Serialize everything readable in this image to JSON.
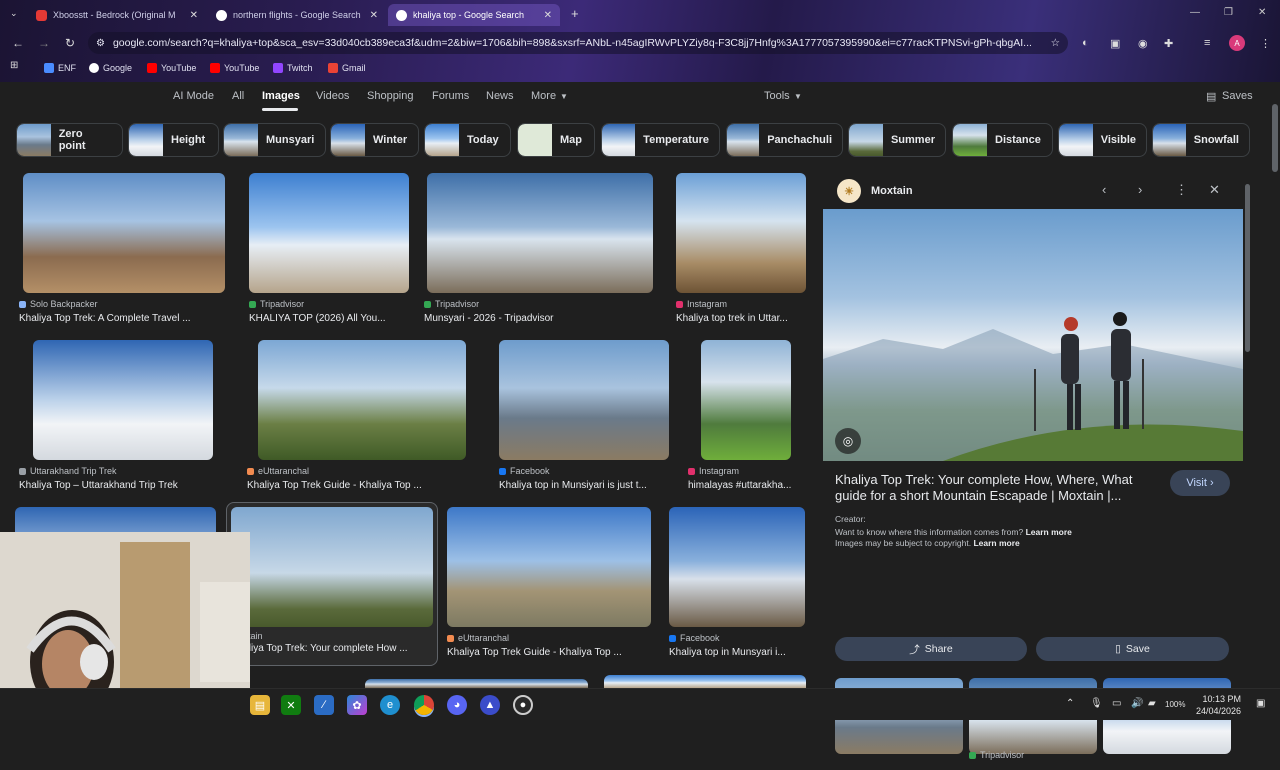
{
  "browser": {
    "tabs": [
      {
        "label": "Xboosstt - Bedrock (Original M",
        "color": "#e53935"
      },
      {
        "label": "northern flights - Google Search",
        "color": "#4285f4"
      },
      {
        "label": "khaliya top - Google Search",
        "color": "#4285f4"
      }
    ],
    "url": "google.com/search?q=khaliya+top&sca_esv=33d040cb389eca3f&udm=2&biw=1706&bih=898&sxsrf=ANbL-n45agIRWvPLYZiy8q-F3C8jj7Hnfg%3A1777057395990&ei=c77racKTPNSvi-gPh-qbgAI...",
    "bookmarks": [
      {
        "label": "ENF",
        "color": "#4a8cff"
      },
      {
        "label": "Google",
        "color": "#ffffff"
      },
      {
        "label": "YouTube",
        "color": "#ff0000"
      },
      {
        "label": "YouTube",
        "color": "#ff0000"
      },
      {
        "label": "Twitch",
        "color": "#9146ff"
      },
      {
        "label": "Gmail",
        "color": "#ea4335"
      }
    ]
  },
  "search_tabs": [
    "AI Mode",
    "All",
    "Images",
    "Videos",
    "Shopping",
    "Forums",
    "News",
    "More"
  ],
  "tools_label": "Tools",
  "saves_label": "Saves",
  "chips": [
    "Zero point",
    "Height",
    "Munsyari",
    "Winter",
    "Today",
    "Map",
    "Temperature",
    "Panchachuli",
    "Summer",
    "Distance",
    "Visible",
    "Snowfall"
  ],
  "results": [
    {
      "source": "Solo Backpacker",
      "title": "Khaliya Top Trek: A Complete Travel ...",
      "color": "#8ab4f8"
    },
    {
      "source": "Tripadvisor",
      "title": "KHALIYA TOP (2026) All You...",
      "color": "#34a853"
    },
    {
      "source": "Tripadvisor",
      "title": "Munsyari - 2026 - Tripadvisor",
      "color": "#34a853"
    },
    {
      "source": "Instagram",
      "title": "Khaliya top trek in Uttar...",
      "color": "#e1306c"
    },
    {
      "source": "Uttarakhand Trip Trek",
      "title": "Khaliya Top – Uttarakhand Trip Trek",
      "color": "#9aa0a6"
    },
    {
      "source": "eUttaranchal",
      "title": "Khaliya Top Trek Guide - Khaliya Top ...",
      "color": "#f28b50"
    },
    {
      "source": "Facebook",
      "title": "Khaliya top in Munsiyari is just t...",
      "color": "#1877f2"
    },
    {
      "source": "Instagram",
      "title": "himalayas #uttarakha...",
      "color": "#e1306c"
    },
    {
      "source": "Moxtain",
      "title": "Khaliya Top Trek: Your complete How ...",
      "color": "#9aa0a6"
    },
    {
      "source": "eUttaranchal",
      "title": "Khaliya Top Trek Guide - Khaliya Top ...",
      "color": "#f28b50"
    },
    {
      "source": "Facebook",
      "title": "Khaliya top in Munsyari i...",
      "color": "#1877f2"
    }
  ],
  "panel": {
    "site": "Moxtain",
    "title": "Khaliya Top Trek: Your complete How, Where, What guide for a short Mountain Escapade | Moxtain |...",
    "visit_label": "Visit",
    "creator_label": "Creator:",
    "info_text": "Want to know where this information comes from?",
    "learn_more": "Learn more",
    "copyright_text": "Images may be subject to copyright.",
    "learn_more_2": "Learn more",
    "share_label": "Share",
    "save_label": "Save",
    "thumb_source": "Tripadvisor"
  },
  "taskbar": {
    "battery": "100%",
    "time": "10:13 PM",
    "date": "24/04/2026"
  }
}
